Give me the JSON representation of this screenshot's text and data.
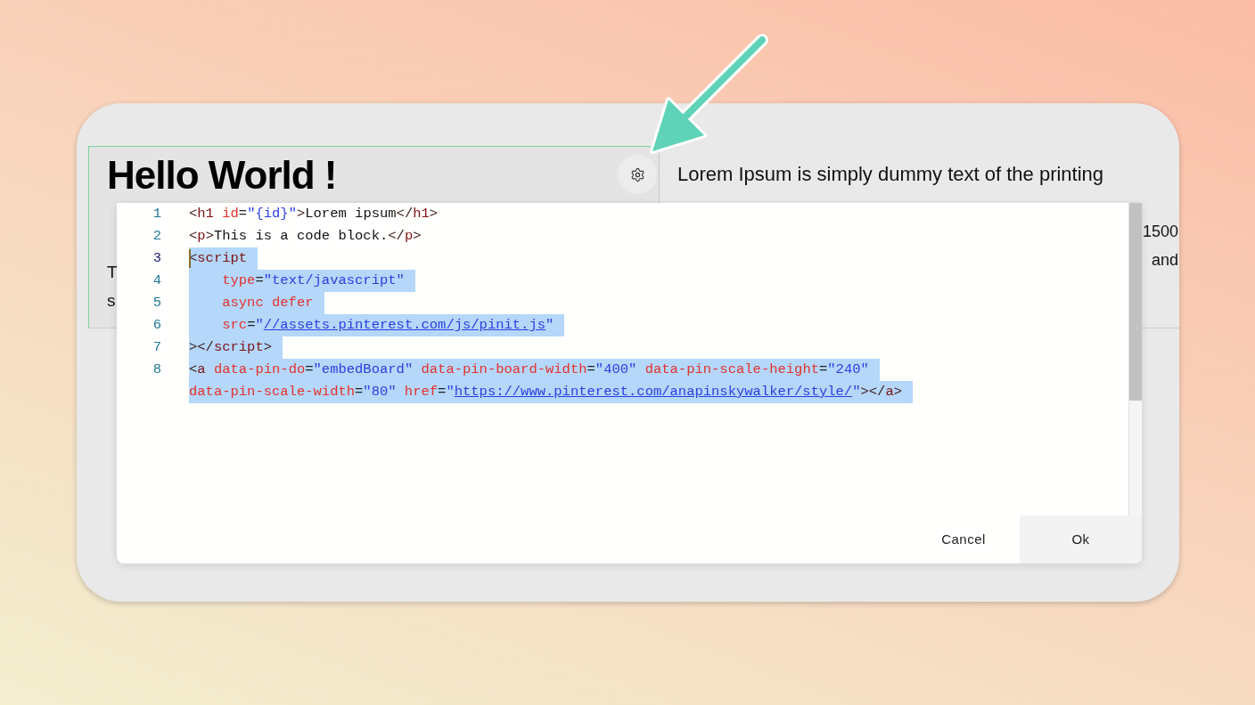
{
  "editor": {
    "heading": "Hello World !",
    "left_paragraph": [
      "T",
      "s"
    ],
    "right_paragraph": [
      "Lorem Ipsum is simply dummy text of the printing"
    ],
    "right_fragments": [
      "1500",
      "and"
    ]
  },
  "code_dialog": {
    "lines": [
      {
        "number": "1",
        "selected": false,
        "cursor": false,
        "rows": [
          {
            "segments": [
              {
                "kind": "bracket",
                "text": "<"
              },
              {
                "kind": "tag",
                "text": "h1"
              },
              {
                "kind": "attr",
                "text": " id"
              },
              {
                "kind": "punct",
                "text": "="
              },
              {
                "kind": "string",
                "text": "\"{id}\""
              },
              {
                "kind": "bracket",
                "text": ">"
              },
              {
                "kind": "text",
                "text": "Lorem ipsum"
              },
              {
                "kind": "bracket",
                "text": "</"
              },
              {
                "kind": "tag",
                "text": "h1"
              },
              {
                "kind": "bracket",
                "text": ">"
              }
            ]
          }
        ]
      },
      {
        "number": "2",
        "selected": false,
        "cursor": false,
        "rows": [
          {
            "segments": [
              {
                "kind": "bracket",
                "text": "<"
              },
              {
                "kind": "tag",
                "text": "p"
              },
              {
                "kind": "bracket",
                "text": ">"
              },
              {
                "kind": "text",
                "text": "This is a code block."
              },
              {
                "kind": "bracket",
                "text": "</"
              },
              {
                "kind": "tag",
                "text": "p"
              },
              {
                "kind": "bracket",
                "text": ">"
              }
            ]
          }
        ]
      },
      {
        "number": "3",
        "selected": true,
        "cursor": true,
        "rows": [
          {
            "segments": [
              {
                "kind": "bracket",
                "text": "<"
              },
              {
                "kind": "tag",
                "text": "script"
              }
            ]
          }
        ]
      },
      {
        "number": "4",
        "selected": true,
        "cursor": false,
        "rows": [
          {
            "segments": [
              {
                "kind": "attr",
                "text": "    type"
              },
              {
                "kind": "punct",
                "text": "="
              },
              {
                "kind": "string",
                "text": "\"text/javascript\""
              }
            ]
          }
        ]
      },
      {
        "number": "5",
        "selected": true,
        "cursor": false,
        "rows": [
          {
            "segments": [
              {
                "kind": "attr",
                "text": "    async defer"
              }
            ]
          }
        ]
      },
      {
        "number": "6",
        "selected": true,
        "cursor": false,
        "rows": [
          {
            "segments": [
              {
                "kind": "attr",
                "text": "    src"
              },
              {
                "kind": "punct",
                "text": "="
              },
              {
                "kind": "string",
                "text": "\""
              },
              {
                "kind": "link",
                "text": "//assets.pinterest.com/js/pinit.js"
              },
              {
                "kind": "string",
                "text": "\""
              }
            ]
          }
        ]
      },
      {
        "number": "7",
        "selected": true,
        "cursor": false,
        "rows": [
          {
            "segments": [
              {
                "kind": "bracket",
                "text": "></"
              },
              {
                "kind": "tag",
                "text": "script"
              },
              {
                "kind": "bracket",
                "text": ">"
              }
            ]
          }
        ]
      },
      {
        "number": "8",
        "selected": true,
        "cursor": false,
        "rows": [
          {
            "segments": [
              {
                "kind": "bracket",
                "text": "<"
              },
              {
                "kind": "tag",
                "text": "a"
              },
              {
                "kind": "attr",
                "text": " data-pin-do"
              },
              {
                "kind": "punct",
                "text": "="
              },
              {
                "kind": "string",
                "text": "\"embedBoard\""
              },
              {
                "kind": "attr",
                "text": " data-pin-board-width"
              },
              {
                "kind": "punct",
                "text": "="
              },
              {
                "kind": "string",
                "text": "\"400\""
              },
              {
                "kind": "attr",
                "text": " data-pin-scale-height"
              },
              {
                "kind": "punct",
                "text": "="
              },
              {
                "kind": "string",
                "text": "\"240\""
              }
            ]
          },
          {
            "segments": [
              {
                "kind": "attr",
                "text": "data-pin-scale-width"
              },
              {
                "kind": "punct",
                "text": "="
              },
              {
                "kind": "string",
                "text": "\"80\""
              },
              {
                "kind": "attr",
                "text": " href"
              },
              {
                "kind": "punct",
                "text": "="
              },
              {
                "kind": "string",
                "text": "\""
              },
              {
                "kind": "link",
                "text": "https://www.pinterest.com/anapinskywalker/style/"
              },
              {
                "kind": "string",
                "text": "\""
              },
              {
                "kind": "bracket",
                "text": "></"
              },
              {
                "kind": "tag",
                "text": "a"
              },
              {
                "kind": "bracket",
                "text": ">"
              }
            ]
          }
        ]
      }
    ],
    "buttons": [
      {
        "label": "Cancel",
        "kind": "secondary"
      },
      {
        "label": "Ok",
        "kind": "primary"
      }
    ]
  }
}
